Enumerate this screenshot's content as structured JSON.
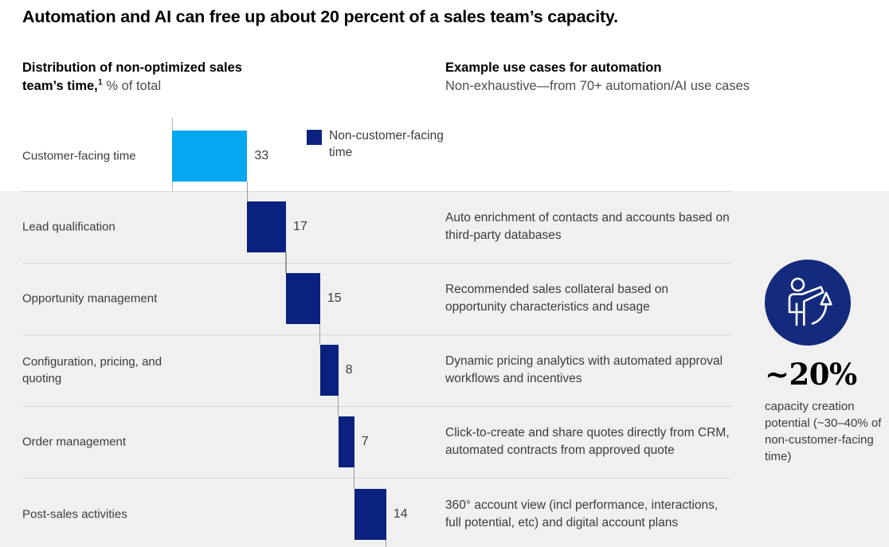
{
  "title": "Automation and AI can free up  about 20 percent of a sales team’s capacity.",
  "headings": {
    "left_strong": "Distribution of non-optimized sales team’s time,",
    "left_footnote_marker": "1",
    "left_light": "% of total",
    "right_strong": "Example use cases for automation",
    "right_light": "Non-exhaustive—from 70+ automation/AI use cases"
  },
  "legend": {
    "label": "Non-customer-facing time",
    "color": "#0a2180"
  },
  "callout": {
    "icon": "person-pointing-up-arrow-icon",
    "value": "~20%",
    "description": "capacity creation potential (~30–40% of non-customer-facing time)",
    "circle_color": "#142a7d"
  },
  "chart_data": {
    "type": "bar",
    "title": "Distribution of non-optimized sales team's time, % of total",
    "subtype": "horizontal-waterfall-cascade",
    "xlabel": "% of total",
    "ylabel": "",
    "xlim": [
      0,
      100
    ],
    "grid": false,
    "legend_position": "top-center",
    "categories": [
      "Customer-facing time",
      "Lead qualification",
      "Opportunity management",
      "Configuration, pricing, and quoting",
      "Order management",
      "Post-sales activities"
    ],
    "values": [
      33,
      17,
      15,
      8,
      7,
      14
    ],
    "cumulative_start": [
      0,
      33,
      50,
      65,
      73,
      80
    ],
    "cumulative_end": [
      33,
      50,
      65,
      73,
      80,
      94
    ],
    "colors": [
      "#04a7f0",
      "#0a2180",
      "#0a2180",
      "#0a2180",
      "#0a2180",
      "#0a2180"
    ],
    "series": [
      {
        "name": "Customer-facing time",
        "values": [
          33
        ]
      },
      {
        "name": "Non-customer-facing time",
        "values": [
          17,
          15,
          8,
          7,
          14
        ]
      }
    ]
  },
  "rows": [
    {
      "category": "Customer-facing time",
      "value": "33",
      "usecase": "",
      "color": "#04a7f0",
      "tint": false
    },
    {
      "category": "Lead qualification",
      "value": "17",
      "usecase": "Auto enrichment of contacts and accounts based on third-party databases",
      "color": "#0a2180",
      "tint": true
    },
    {
      "category": "Opportunity management",
      "value": "15",
      "usecase": "Recommended sales collateral based on opportunity characteristics and usage",
      "color": "#0a2180",
      "tint": true
    },
    {
      "category": "Configuration, pricing, and quoting",
      "value": "8",
      "usecase": "Dynamic pricing analytics with automated approval workflows and incentives",
      "color": "#0a2180",
      "tint": true
    },
    {
      "category": "Order management",
      "value": "7",
      "usecase": "Click-to-create and share quotes directly from CRM, automated contracts from approved quote",
      "color": "#0a2180",
      "tint": true
    },
    {
      "category": "Post-sales activities",
      "value": "14",
      "usecase": "360° account view (incl performance, interactions, full potential, etc) and digital account plans",
      "color": "#0a2180",
      "tint": true
    }
  ]
}
